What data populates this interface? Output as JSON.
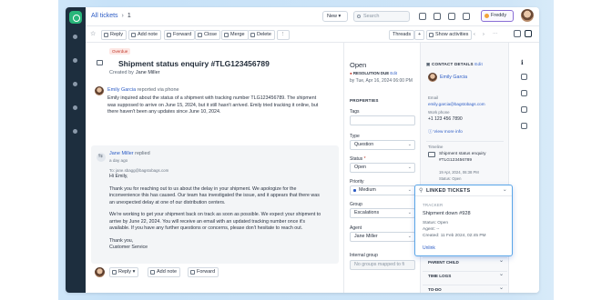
{
  "topbar": {
    "breadcrumb_all": "All tickets",
    "breadcrumb_sep": "›",
    "breadcrumb_count": "1",
    "new_label": "New ▾",
    "search_placeholder": "Search",
    "freddy_label": "Freddy"
  },
  "toolbar": {
    "reply": "Reply",
    "add_note": "Add note",
    "forward": "Forward",
    "close": "Close",
    "merge": "Merge",
    "delete": "Delete",
    "more": "⋮",
    "threads": "Threads",
    "plus": "+",
    "show_activities": "Show activities"
  },
  "ticket": {
    "status_chip": "Overdue",
    "subject": "Shipment status enquiry #TLG123456789",
    "created_by_label": "Created by",
    "created_by": "Jane Miller",
    "message1": {
      "author": "Emily Garcia",
      "meta": "reported via phone",
      "lines": [
        "Emily inquired about the status of a shipment with tracking number TLG123456789. The shipment",
        "was supposed to arrive on June 15, 2024, but it still hasn't arrived. Emily tried tracking it online, but",
        "there haven't been any updates since June 10, 2024."
      ]
    },
    "reply": {
      "author": "Jane Miller",
      "meta": "replied",
      "time": "a day ago",
      "to": "To: jane.sbagg@bagstobags.com",
      "greeting": "Hi Emily,",
      "p1": [
        "Thank you for reaching out to us about the delay in your shipment. We apologize for the",
        "inconvenience this has caused. Our team has investigated the issue, and it appears that there was",
        "an unexpected delay at one of our distribution centers."
      ],
      "p2": [
        "We're working to get your shipment back on track as soon as possible. We expect your shipment to",
        "arrive by June 22, 2024. You will receive an email with an updated tracking number once it's",
        "available. If you have any further questions or concerns, please don't hesitate to reach out."
      ],
      "signoff": [
        "Thank you,",
        "Customer Service"
      ]
    },
    "bottom": {
      "reply": "Reply",
      "add_note": "Add note",
      "forward": "Forward"
    }
  },
  "properties": {
    "status": "Open",
    "resolution_due_label": "RESOLUTION DUE",
    "edit": "Edit",
    "resolution_due": "by Tue, Apr 16, 2024 06:00 PM",
    "heading": "PROPERTIES",
    "tags_label": "Tags",
    "type_label": "Type",
    "type_value": "Question",
    "status_label": "Status",
    "status_value": "Open",
    "priority_label": "Priority",
    "priority_value": "Medium",
    "group_label": "Group",
    "group_value": "Escalations",
    "agent_label": "Agent",
    "agent_value": "Jane Miller",
    "internal_group_label": "Internal group",
    "internal_group_value": "No groups mapped to fi"
  },
  "contact": {
    "heading": "CONTACT DETAILS",
    "edit": "Edit",
    "name": "Emily Garcia",
    "email_label": "Email",
    "email": "emily.garcia@bagstobags.com",
    "phone_label": "Work phone",
    "phone": "+1 123 456 7890",
    "view_more": "View more info",
    "timeline_label": "Timeline",
    "timeline_title": [
      "Shipment status enquiry",
      "#TLG123456789"
    ],
    "timeline_date": "19 Apr, 2024, 06:38 PM",
    "timeline_status": "Status: Open"
  },
  "linked": {
    "heading": "LINKED TICKETS",
    "tracker_label": "TRACKER",
    "title": "Shipment down #928",
    "status": "Status: Open",
    "agent": "Agent: --",
    "created": "Created: 11 Feb 2024, 02:45 PM",
    "unlink": "Unlink"
  },
  "accordions": {
    "parent_child": "PARENT CHILD",
    "time_logs": "TIME LOGS",
    "to_do": "TO-DO"
  },
  "colors": {
    "accent": "#2c5cc5",
    "rail": "#1d2e3e",
    "overdue": "#c0392b",
    "linked_border": "#5aa6e8"
  }
}
